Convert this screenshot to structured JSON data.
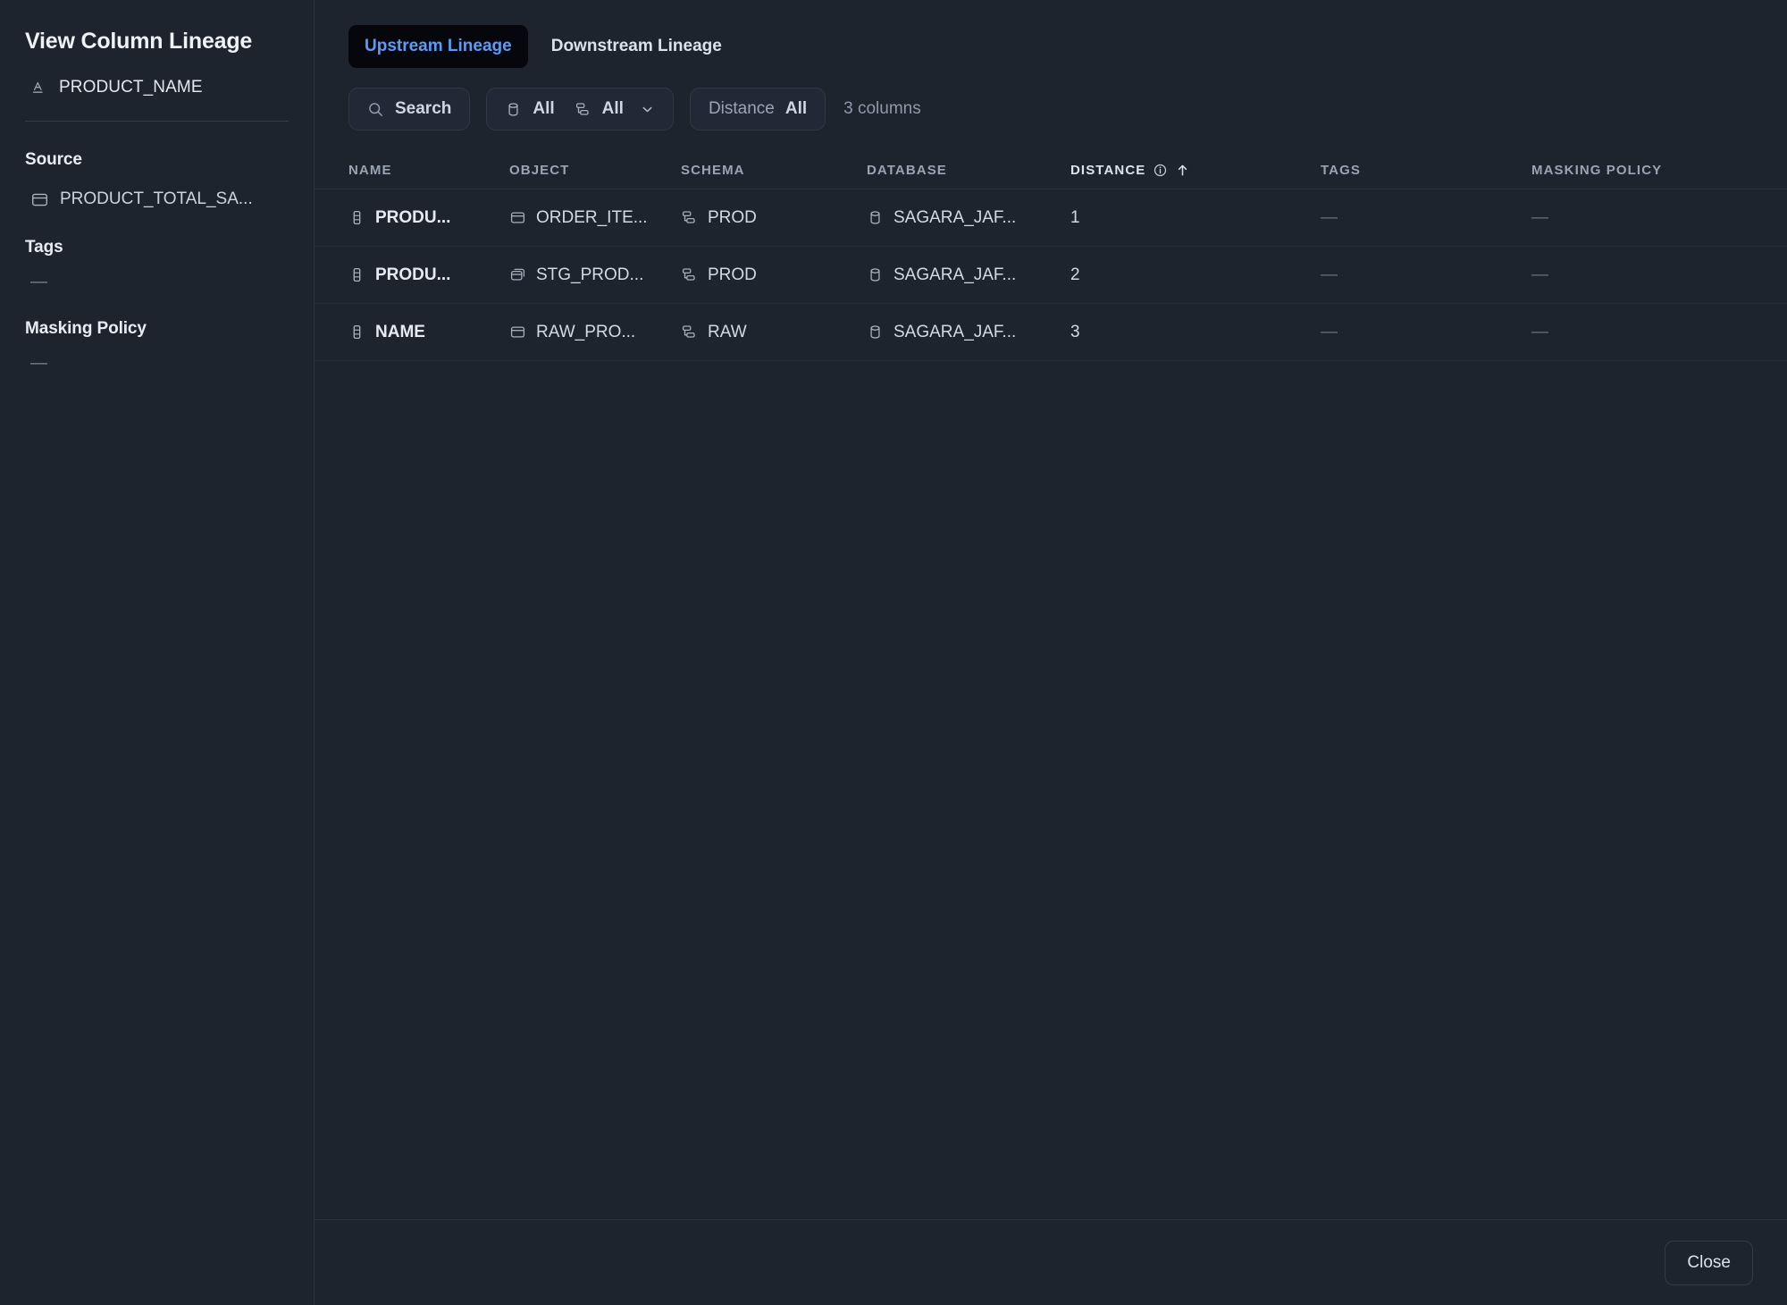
{
  "sidebar": {
    "title": "View Column Lineage",
    "column": {
      "icon": "text-column-icon",
      "name": "PRODUCT_NAME"
    },
    "source": {
      "heading": "Source",
      "icon": "table-icon",
      "name": "PRODUCT_TOTAL_SA..."
    },
    "tags": {
      "heading": "Tags",
      "value": "—"
    },
    "masking_policy": {
      "heading": "Masking Policy",
      "value": "—"
    }
  },
  "tabs": [
    {
      "label": "Upstream Lineage",
      "active": true
    },
    {
      "label": "Downstream Lineage",
      "active": false
    }
  ],
  "toolbar": {
    "search_label": "Search",
    "search_icon": "search-icon",
    "database_filter": {
      "icon": "database-icon",
      "value": "All"
    },
    "schema_filter": {
      "icon": "schema-icon",
      "value": "All",
      "chevron": "chevron-down-icon"
    },
    "distance_filter": {
      "label": "Distance",
      "value": "All"
    },
    "result_count": "3 columns"
  },
  "table": {
    "columns": [
      {
        "key": "name",
        "label": "NAME"
      },
      {
        "key": "object",
        "label": "OBJECT"
      },
      {
        "key": "schema",
        "label": "SCHEMA"
      },
      {
        "key": "database",
        "label": "DATABASE"
      },
      {
        "key": "distance",
        "label": "DISTANCE",
        "info_icon": "info-icon",
        "sort_icon": "sort-ascending-arrow-icon",
        "sorted": true
      },
      {
        "key": "tags",
        "label": "TAGS"
      },
      {
        "key": "masking",
        "label": "MASKING POLICY"
      }
    ],
    "rows": [
      {
        "name": "PRODU...",
        "name_icon": "column-icon",
        "object": "ORDER_ITE...",
        "object_icon": "table-icon",
        "schema": "PROD",
        "schema_icon": "schema-icon",
        "database": "SAGARA_JAF...",
        "database_icon": "database-icon",
        "distance": "1",
        "tags": "—",
        "masking": "—"
      },
      {
        "name": "PRODU...",
        "name_icon": "column-icon",
        "object": "STG_PROD...",
        "object_icon": "view-icon",
        "schema": "PROD",
        "schema_icon": "schema-icon",
        "database": "SAGARA_JAF...",
        "database_icon": "database-icon",
        "distance": "2",
        "tags": "—",
        "masking": "—"
      },
      {
        "name": "NAME",
        "name_icon": "column-icon",
        "object": "RAW_PRO...",
        "object_icon": "table-icon",
        "schema": "RAW",
        "schema_icon": "schema-icon",
        "database": "SAGARA_JAF...",
        "database_icon": "database-icon",
        "distance": "3",
        "tags": "—",
        "masking": "—"
      }
    ]
  },
  "footer": {
    "close_label": "Close"
  },
  "colors": {
    "background": "#1e242e",
    "accent_blue": "#5a9cf8",
    "active_tab_bg": "#05070c",
    "border": "#2c3440",
    "text_primary": "#e6ebf2",
    "text_muted": "#9aa4b4"
  }
}
